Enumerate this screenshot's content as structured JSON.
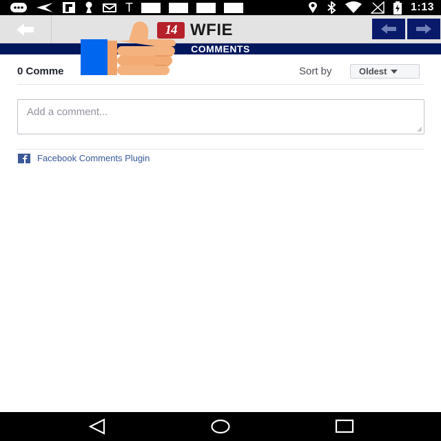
{
  "status_bar": {
    "time": "1:13",
    "glyph_t": "T",
    "icons": [
      "messaging-icon",
      "send-icon",
      "flipboard-icon",
      "keyhole-icon",
      "mail-icon",
      "text-icon",
      "location-icon",
      "bluetooth-icon",
      "wifi-icon",
      "no-signal-icon",
      "battery-charging-icon"
    ]
  },
  "toolbar": {
    "logo_number": "14",
    "logo_text": "WFIE",
    "brand_color": "#b5202a",
    "nav_color": "#0a1a6b"
  },
  "banner": {
    "title": "COMMENTS",
    "color": "#00175e"
  },
  "comments": {
    "count_label": "0 Comme",
    "sort_label": "Sort by",
    "sort_value": "Oldest",
    "input_placeholder": "Add a comment..."
  },
  "footer": {
    "plugin_label": "Facebook Comments Plugin"
  },
  "overlay": {
    "icon": "thumbs-up-icon",
    "cuff_color": "#0066ee",
    "skin_color": "#f4b27e"
  },
  "nav_bar": {
    "icons": [
      "back-triangle-icon",
      "home-circle-icon",
      "recents-square-icon"
    ]
  }
}
